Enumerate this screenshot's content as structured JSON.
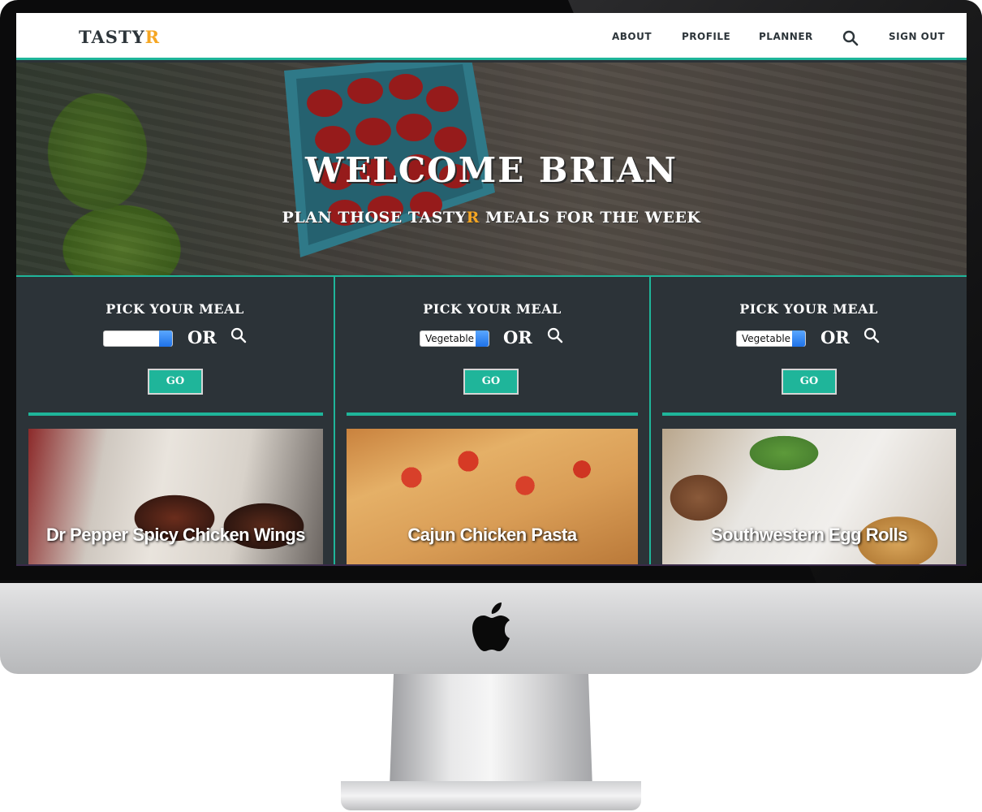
{
  "nav": {
    "logo_main": "TASTY",
    "logo_accent": "R",
    "links": [
      "ABOUT",
      "PROFILE",
      "PLANNER",
      "SIGN OUT"
    ]
  },
  "hero": {
    "title": "WELCOME BRIAN",
    "subtitle_before": "PLAN THOSE TASTY",
    "subtitle_accent": "R",
    "subtitle_after": " MEALS FOR THE WEEK"
  },
  "columns": [
    {
      "pick_label": "PICK YOUR MEAL",
      "select_value": "",
      "or_label": "OR",
      "go_label": "GO",
      "meal_title": "Dr Pepper Spicy Chicken Wings"
    },
    {
      "pick_label": "PICK YOUR MEAL",
      "select_value": "Vegetable",
      "or_label": "OR",
      "go_label": "GO",
      "meal_title": "Cajun Chicken Pasta"
    },
    {
      "pick_label": "PICK YOUR MEAL",
      "select_value": "Vegetable",
      "or_label": "OR",
      "go_label": "GO",
      "meal_title": "Southwestern Egg Rolls"
    }
  ],
  "colors": {
    "accent": "#1fb59a",
    "logo_accent": "#f5a623",
    "panel": "#2c3338"
  },
  "icons": [
    "search-icon",
    "apple-logo-icon",
    "select-arrows-icon"
  ]
}
